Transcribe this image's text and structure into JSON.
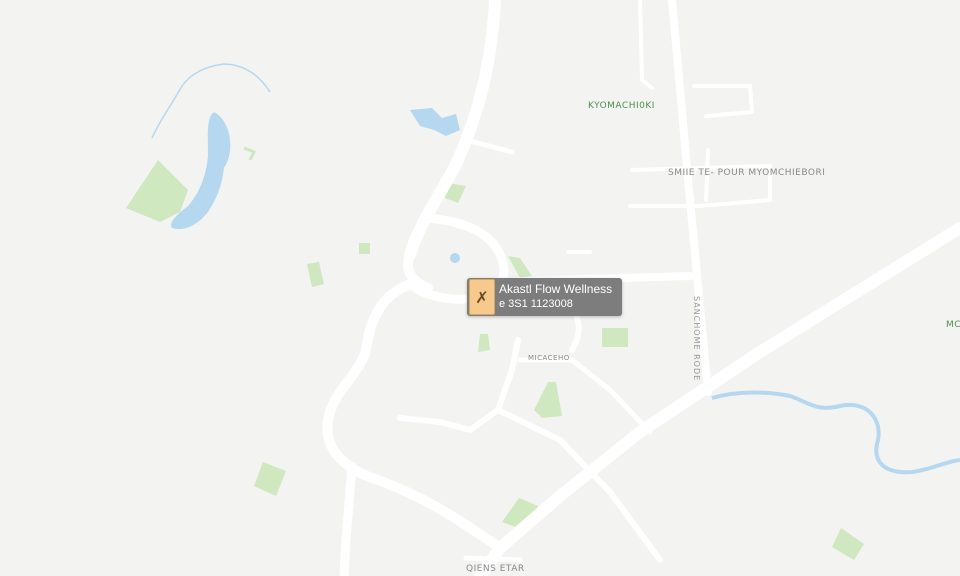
{
  "map": {
    "labels": {
      "kyomachi": "KYOMACHI0KI",
      "district": "SMIIE TE- POUR MYOMCHIEBORI",
      "road_vertical": "SANCHOME RODE",
      "small_road": "MICACEHO",
      "bottom": "QIENS ETAR",
      "right_edge": "MC"
    },
    "colors": {
      "land": "#f3f3f1",
      "road": "#ffffff",
      "park": "#c9e6b8",
      "water": "#b5d8f0"
    }
  },
  "poi": {
    "name": "Akastl Flow Wellness",
    "phone": "e 3S1 1123008",
    "icon": "yoga-pose-icon"
  }
}
